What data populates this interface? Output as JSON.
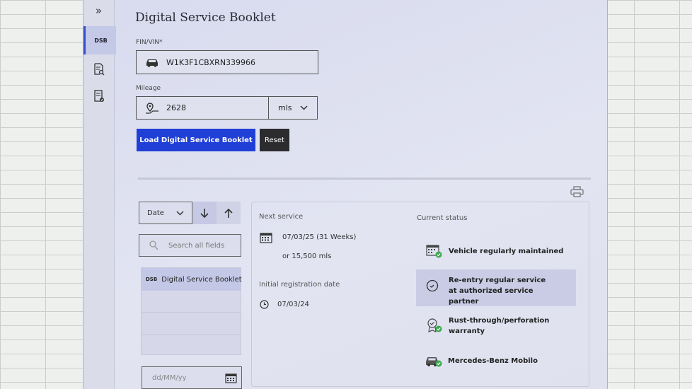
{
  "rail": {
    "expand_icon": "double-chevron-right",
    "active_label": "DSB"
  },
  "page": {
    "title": "Digital Service Booklet"
  },
  "form": {
    "vin_label": "FIN/VIN*",
    "vin_value": "W1K3F1CBXRN339966",
    "mileage_label": "Mileage",
    "mileage_value": "2628",
    "unit_value": "mls",
    "load_button": "Load Digital Service Booklet",
    "reset_button": "Reset"
  },
  "sidebar": {
    "sort_value": "Date",
    "search_placeholder": "Search all fields",
    "items": [
      {
        "tag": "DSB",
        "label": "Digital Service Booklet"
      }
    ],
    "date_placeholder": "dd/MM/yy"
  },
  "details": {
    "next_service_label": "Next service",
    "next_service_date": "07/03/25 (31 Weeks)",
    "next_service_mileage": "or 15,500 mls",
    "initial_registration_label": "Initial registration date",
    "initial_registration_date": "07/03/24"
  },
  "current_status": {
    "label": "Current status",
    "items": [
      {
        "label": "Vehicle regularly maintained",
        "icon": "calendar-check-icon"
      },
      {
        "label": "Re-entry regular service at authorized service partner",
        "icon": "clock-icon"
      },
      {
        "label": "Rust-through/perforation warranty",
        "icon": "badge-check-icon"
      },
      {
        "label": "Mercedes-Benz Mobilo",
        "icon": "car-check-icon"
      }
    ]
  },
  "colors": {
    "primary": "#1f3fd6",
    "check": "#3aa84a",
    "active_rail": "#3550d0"
  }
}
